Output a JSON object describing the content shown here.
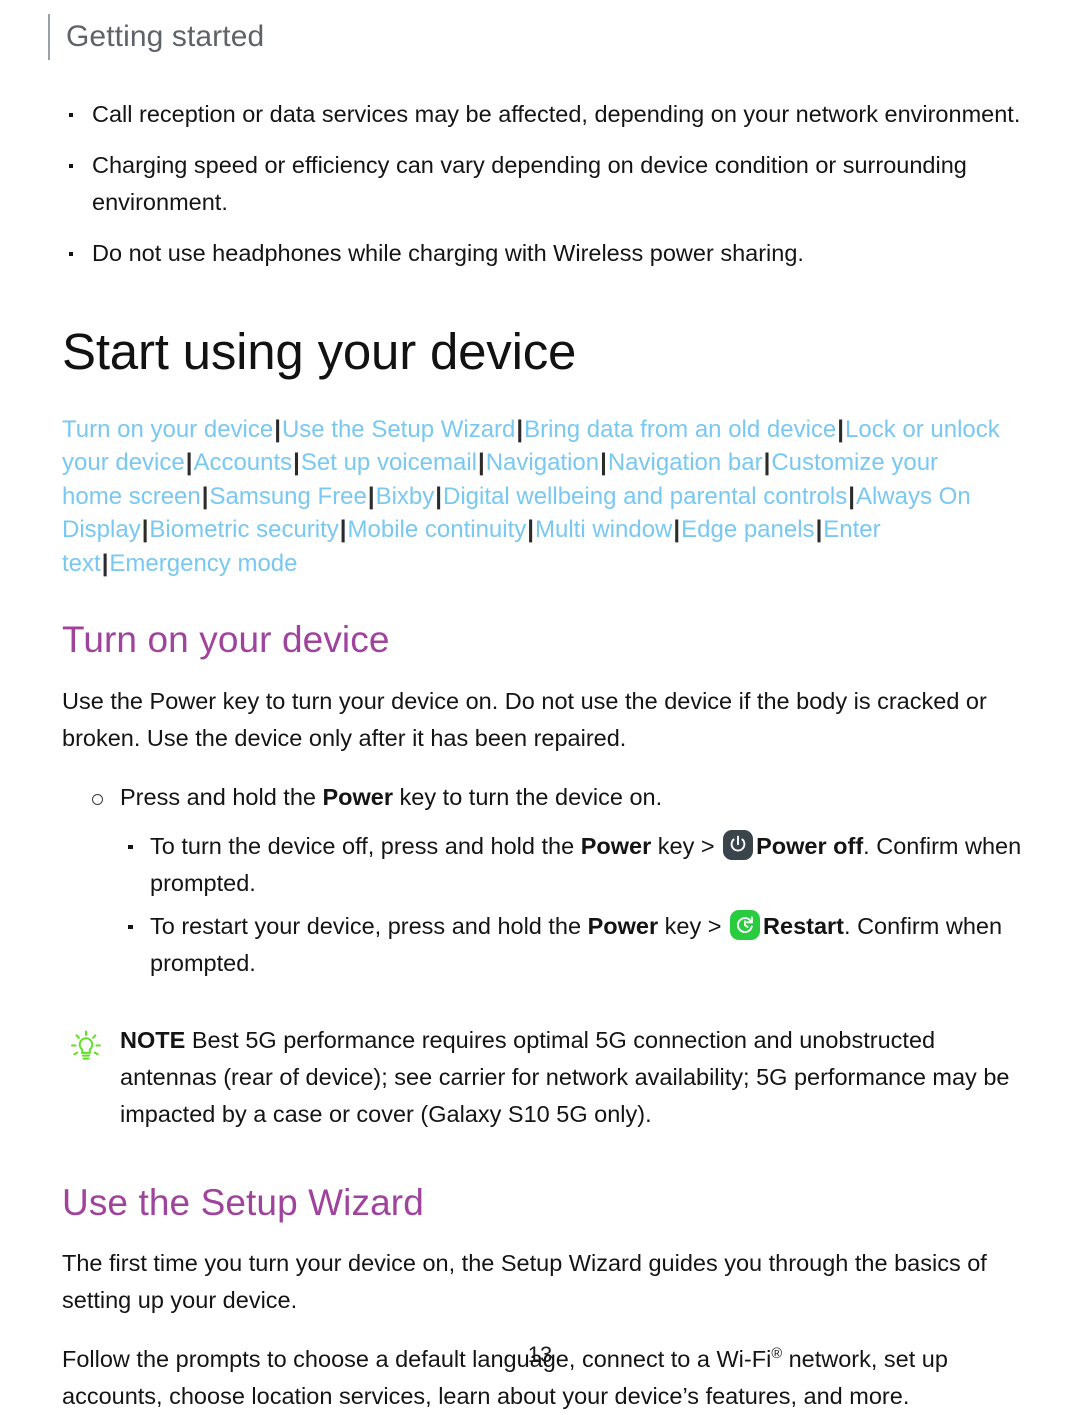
{
  "header": {
    "title": "Getting started"
  },
  "intro_bullets": [
    "Call reception or data services may be affected, depending on your network environment.",
    "Charging speed or efficiency can vary depending on device condition or surrounding environment.",
    "Do not use headphones while charging with Wireless power sharing."
  ],
  "doc_title": "Start using your device",
  "links": [
    "Turn on your device",
    "Use the Setup Wizard",
    "Bring data from an old device",
    "Lock or unlock your device",
    "Accounts",
    "Set up voicemail",
    "Navigation",
    "Navigation bar",
    "Customize your home screen",
    "Samsung Free",
    "Bixby",
    "Digital wellbeing and parental controls",
    "Always On Display",
    "Biometric security",
    "Mobile continuity",
    "Multi window",
    "Edge panels",
    "Enter text",
    "Emergency mode"
  ],
  "link_separator": "|",
  "section_turn_on": {
    "heading": "Turn on your device",
    "paragraph": "Use the Power key to turn your device on. Do not use the device if the body is cracked or broken. Use the device only after it has been repaired.",
    "circle_bullet": {
      "pre": "Press and hold the ",
      "bold": "Power",
      "post": " key to turn the device on."
    },
    "steps": [
      {
        "pre": "To turn the device off, press and hold the ",
        "bold_key": "Power",
        "mid": " key > ",
        "icon": "power-off-icon",
        "bold_action": "Power off",
        "post": ". Confirm when prompted."
      },
      {
        "pre": "To restart your device, press and hold the ",
        "bold_key": "Power",
        "mid": " key > ",
        "icon": "restart-icon",
        "bold_action": "Restart",
        "post": ". Confirm when prompted."
      }
    ]
  },
  "note": {
    "icon": "lightbulb-icon",
    "label": "NOTE",
    "text": "Best 5G performance requires optimal 5G connection and unobstructed antennas (rear of device); see carrier for network availability; 5G performance may be impacted by a case or cover (Galaxy S10 5G only)."
  },
  "section_setup_wizard": {
    "heading": "Use the Setup Wizard",
    "paragraph_1": "The first time you turn your device on, the Setup Wizard guides you through the basics of setting up your device.",
    "paragraph_2_pre": "Follow the prompts to choose a default language, connect to a Wi-Fi",
    "paragraph_2_sup": "®",
    "paragraph_2_post": " network, set up accounts, choose location services, learn about your device’s features, and more."
  },
  "page_number": "13",
  "colors": {
    "link": "#79c8f2",
    "heading_magenta": "#a0439c",
    "note_green": "#5fe020",
    "restart_green": "#29cc3f",
    "power_off_slate": "#3a444b",
    "header_gray": "#5f6368"
  }
}
